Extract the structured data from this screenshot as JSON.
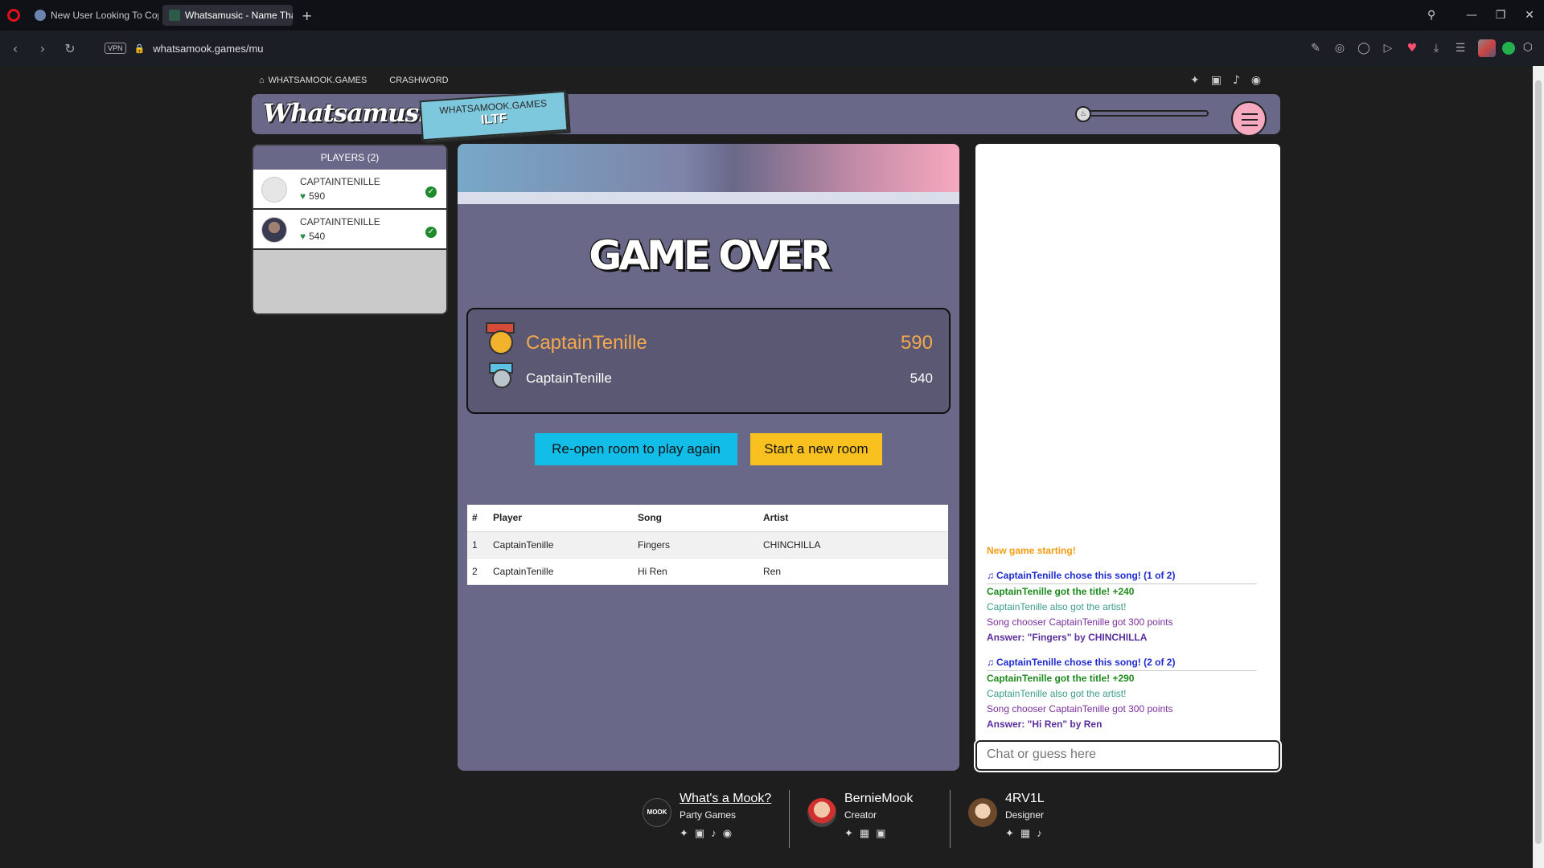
{
  "browser": {
    "tabs": [
      {
        "title": "New User Looking To Cop",
        "active": false
      },
      {
        "title": "Whatsamusic - Name Tha",
        "active": true
      }
    ],
    "new_tab": "+",
    "url": "whatsamook.games/mu",
    "vpn": "VPN"
  },
  "topnav": {
    "home": "WHATSAMOOK.GAMES",
    "crashword": "CRASHWORD"
  },
  "header": {
    "logo": "Whatsamusic",
    "sticker_line1": "WHATSAMOOK.GAMES",
    "sticker_line2": "ILTF"
  },
  "players": {
    "title": "PLAYERS (2)",
    "list": [
      {
        "name": "CAPTAINTENILLE",
        "score": "590"
      },
      {
        "name": "CAPTAINTENILLE",
        "score": "540"
      }
    ]
  },
  "game": {
    "title": "GAME OVER",
    "results": [
      {
        "name": "CaptainTenille",
        "score": "590"
      },
      {
        "name": "CaptainTenille",
        "score": "540"
      }
    ],
    "reopen_label": "Re-open room to play again",
    "newroom_label": "Start a new room",
    "table": {
      "headers": [
        "#",
        "Player",
        "Song",
        "Artist"
      ],
      "rows": [
        [
          "1",
          "CaptainTenille",
          "Fingers",
          "CHINCHILLA"
        ],
        [
          "2",
          "CaptainTenille",
          "Hi Ren",
          "Ren"
        ]
      ]
    }
  },
  "chat": {
    "messages": {
      "start": "New game starting!",
      "r1_chose": "CaptainTenille chose this song! (1 of 2)",
      "r1_title": "CaptainTenille got the title! +240",
      "r1_artist": "CaptainTenille also got the artist!",
      "r1_chooser": "Song chooser CaptainTenille got 300 points",
      "r1_answer": "Answer: \"Fingers\" by CHINCHILLA",
      "r2_chose": "CaptainTenille chose this song! (2 of 2)",
      "r2_title": "CaptainTenille got the title! +290",
      "r2_artist": "CaptainTenille also got the artist!",
      "r2_chooser": "Song chooser CaptainTenille got 300 points",
      "r2_answer": "Answer: \"Hi Ren\" by Ren"
    },
    "placeholder": "Chat or guess here"
  },
  "footer": {
    "mook": {
      "name": "What's a Mook?",
      "role": "Party Games",
      "avatar_text": "MOOK"
    },
    "bernie": {
      "name": "BernieMook",
      "role": "Creator"
    },
    "arv": {
      "name": "4RV1L",
      "role": "Designer"
    }
  },
  "colors": {
    "panel": "#6a6888",
    "accent_orange": "#f4a94e",
    "reopen_button": "#12bde8",
    "newroom_button": "#f8c120"
  }
}
